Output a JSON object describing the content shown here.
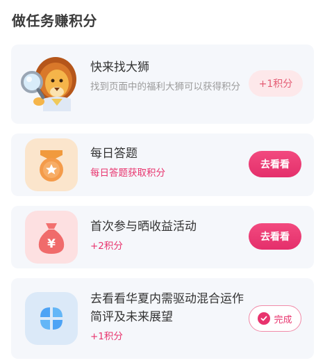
{
  "section": {
    "title": "做任务赚积分"
  },
  "tasks": [
    {
      "title": "快来找大狮",
      "desc": "找到页面中的福利大狮可以获得积分",
      "action": "+1积分",
      "icon": "lion-mascot-icon"
    },
    {
      "title": "每日答题",
      "desc": "每日答题获取积分",
      "action": "去看看",
      "icon": "medal-icon"
    },
    {
      "title": "首次参与晒收益活动",
      "desc": "+2积分",
      "action": "去看看",
      "icon": "money-bag-icon"
    },
    {
      "title": "去看看华夏内需驱动混合运作简评及未来展望",
      "desc": "+1积分",
      "action": "完成",
      "icon": "apps-grid-icon"
    }
  ],
  "colors": {
    "accent": "#e8336d",
    "card_bg": "#f5f7fb",
    "points_badge_bg": "#fde8ea"
  }
}
